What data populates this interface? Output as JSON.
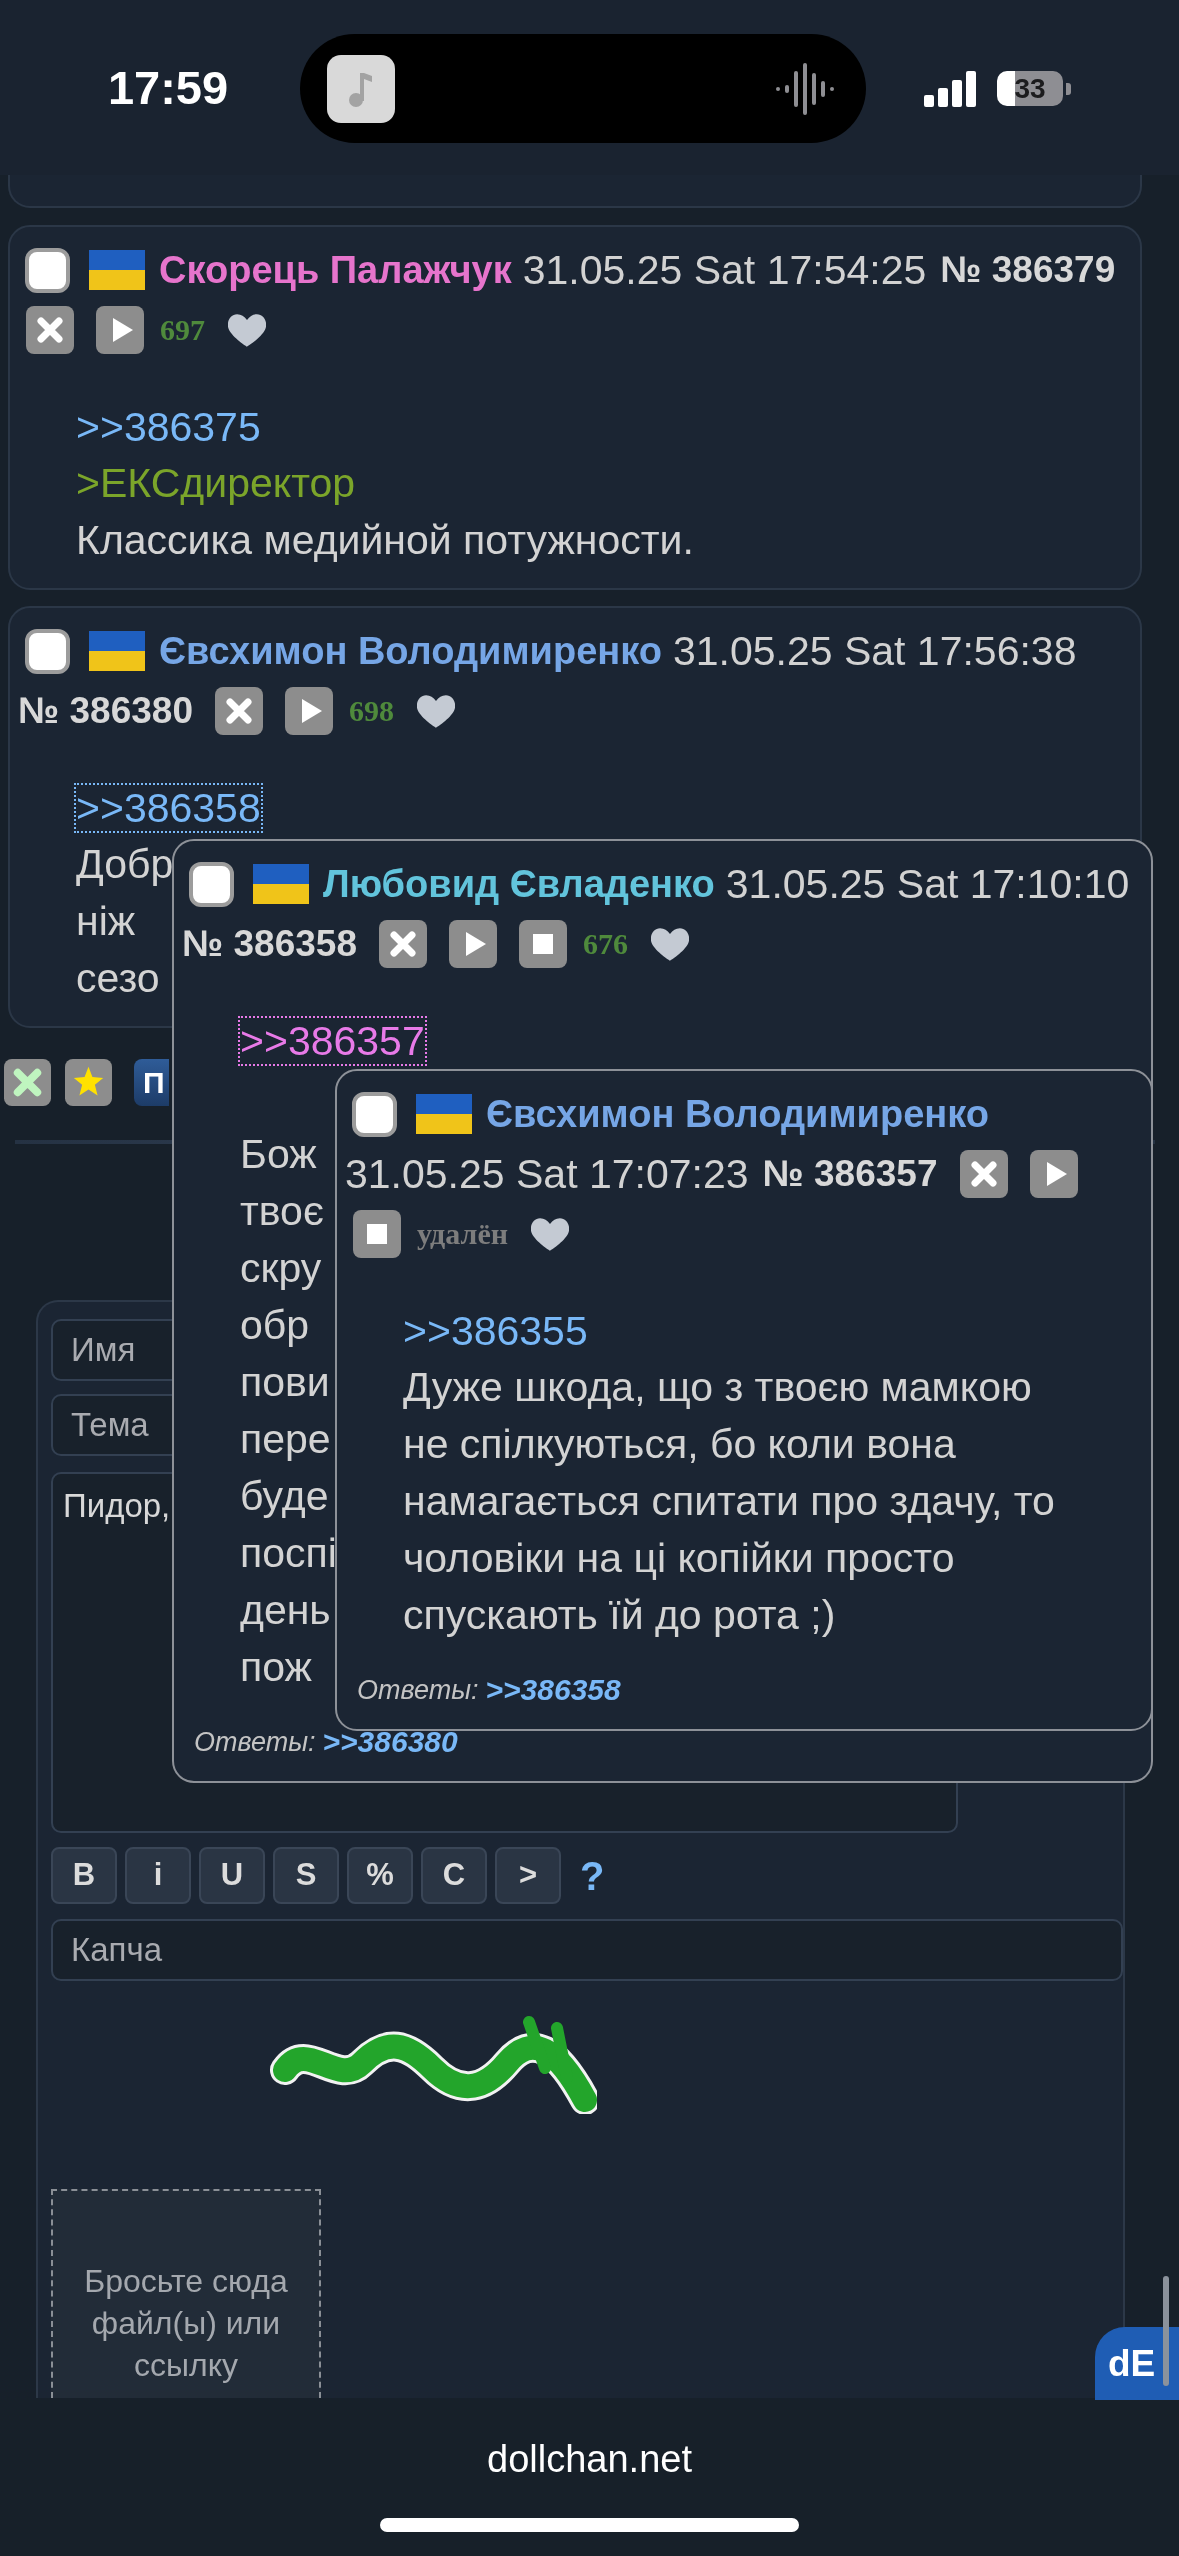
{
  "status_bar": {
    "time": "17:59",
    "battery": "33"
  },
  "posts": [
    {
      "checked": false,
      "name": "Скорець Палажчук",
      "color": "#e674cc",
      "date": "31.05.25 Sat 17:54:25",
      "number": "№ 386379",
      "actions": [
        {
          "kind": "close"
        },
        {
          "kind": "play"
        }
      ],
      "counter": "697",
      "deleted": false,
      "body": [
        {
          "kind": "link",
          "text": ">>386375",
          "color": "#79b8f7",
          "outlined": false
        },
        {
          "kind": "quote",
          "text": ">ЕКСдиректор"
        },
        {
          "kind": "text",
          "text": "Классика медийной потужности."
        }
      ]
    },
    {
      "checked": false,
      "name": "Євсхимон Володимиренко",
      "color": "#76a6e6",
      "date": "31.05.25 Sat 17:56:38",
      "number": "№ 386380",
      "actions": [
        {
          "kind": "close"
        },
        {
          "kind": "play"
        }
      ],
      "counter": "698",
      "deleted": false,
      "body": [
        {
          "kind": "link",
          "text": ">>386358",
          "color": "#79b8f7",
          "outlined": true
        },
        {
          "kind": "text",
          "text": "Добр"
        },
        {
          "kind": "text",
          "text": "ніж"
        },
        {
          "kind": "text",
          "text": "сезо"
        }
      ]
    }
  ],
  "post_toolbar": {
    "button": "П"
  },
  "reply_form": {
    "name_field": {
      "placeholder": "Имя"
    },
    "subject_field": {
      "placeholder": "Тема"
    },
    "message_field": {
      "value": "Пидор,"
    },
    "format_buttons": [
      "B",
      "i",
      "U",
      "S",
      "%",
      "C",
      ">"
    ],
    "help_link": "?",
    "captcha_field": {
      "placeholder": "Капча"
    },
    "drop_zone": "Бросьте сюда файл(ы) или ссылку"
  },
  "popups": [
    {
      "checked": false,
      "name": "Любовид Євладенко",
      "color": "#62c4dc",
      "date": "31.05.25 Sat 17:10:10",
      "number": "№ 386358",
      "actions": [
        {
          "kind": "close"
        },
        {
          "kind": "play"
        },
        {
          "kind": "stop"
        }
      ],
      "counter": "676",
      "deleted": false,
      "body": [
        {
          "kind": "link",
          "text": ">>386357",
          "color": "#e87ae8",
          "outlined": true
        },
        {
          "kind": "text",
          "text": "Бож",
          "blank_line_before": true
        },
        {
          "kind": "text",
          "text": "твоє"
        },
        {
          "kind": "text",
          "text": "скру"
        },
        {
          "kind": "text",
          "text": "обр"
        },
        {
          "kind": "text",
          "text": "пови"
        },
        {
          "kind": "text",
          "text": "пере"
        },
        {
          "kind": "text",
          "text": "буде"
        },
        {
          "kind": "text",
          "text": "поспі"
        },
        {
          "kind": "text",
          "text": "день"
        },
        {
          "kind": "text",
          "text": "пож"
        }
      ],
      "replies_label": "Ответы:",
      "replies": [
        ">>386380"
      ]
    },
    {
      "checked": false,
      "name": "Євсхимон Володимиренко",
      "color": "#76a6e6",
      "date": "31.05.25 Sat 17:07:23",
      "number": "№ 386357",
      "actions": [
        {
          "kind": "close"
        },
        {
          "kind": "play"
        },
        {
          "kind": "stop"
        }
      ],
      "counter": "удалён",
      "deleted": true,
      "body": [
        {
          "kind": "link",
          "text": ">>386355",
          "color": "#79b8f7",
          "outlined": false
        },
        {
          "kind": "text",
          "text": "Дуже шкода, що з твоєю мамкою не спілкуються, бо коли вона намагається спитати про здачу, то чоловіки на ці копійки просто спускають їй до рота ;)"
        }
      ],
      "replies_label": "Ответы:",
      "replies": [
        ">>386358"
      ]
    }
  ],
  "browser_bar": {
    "url": "dollchan.net"
  },
  "logo_badge": {
    "label": "dE"
  }
}
